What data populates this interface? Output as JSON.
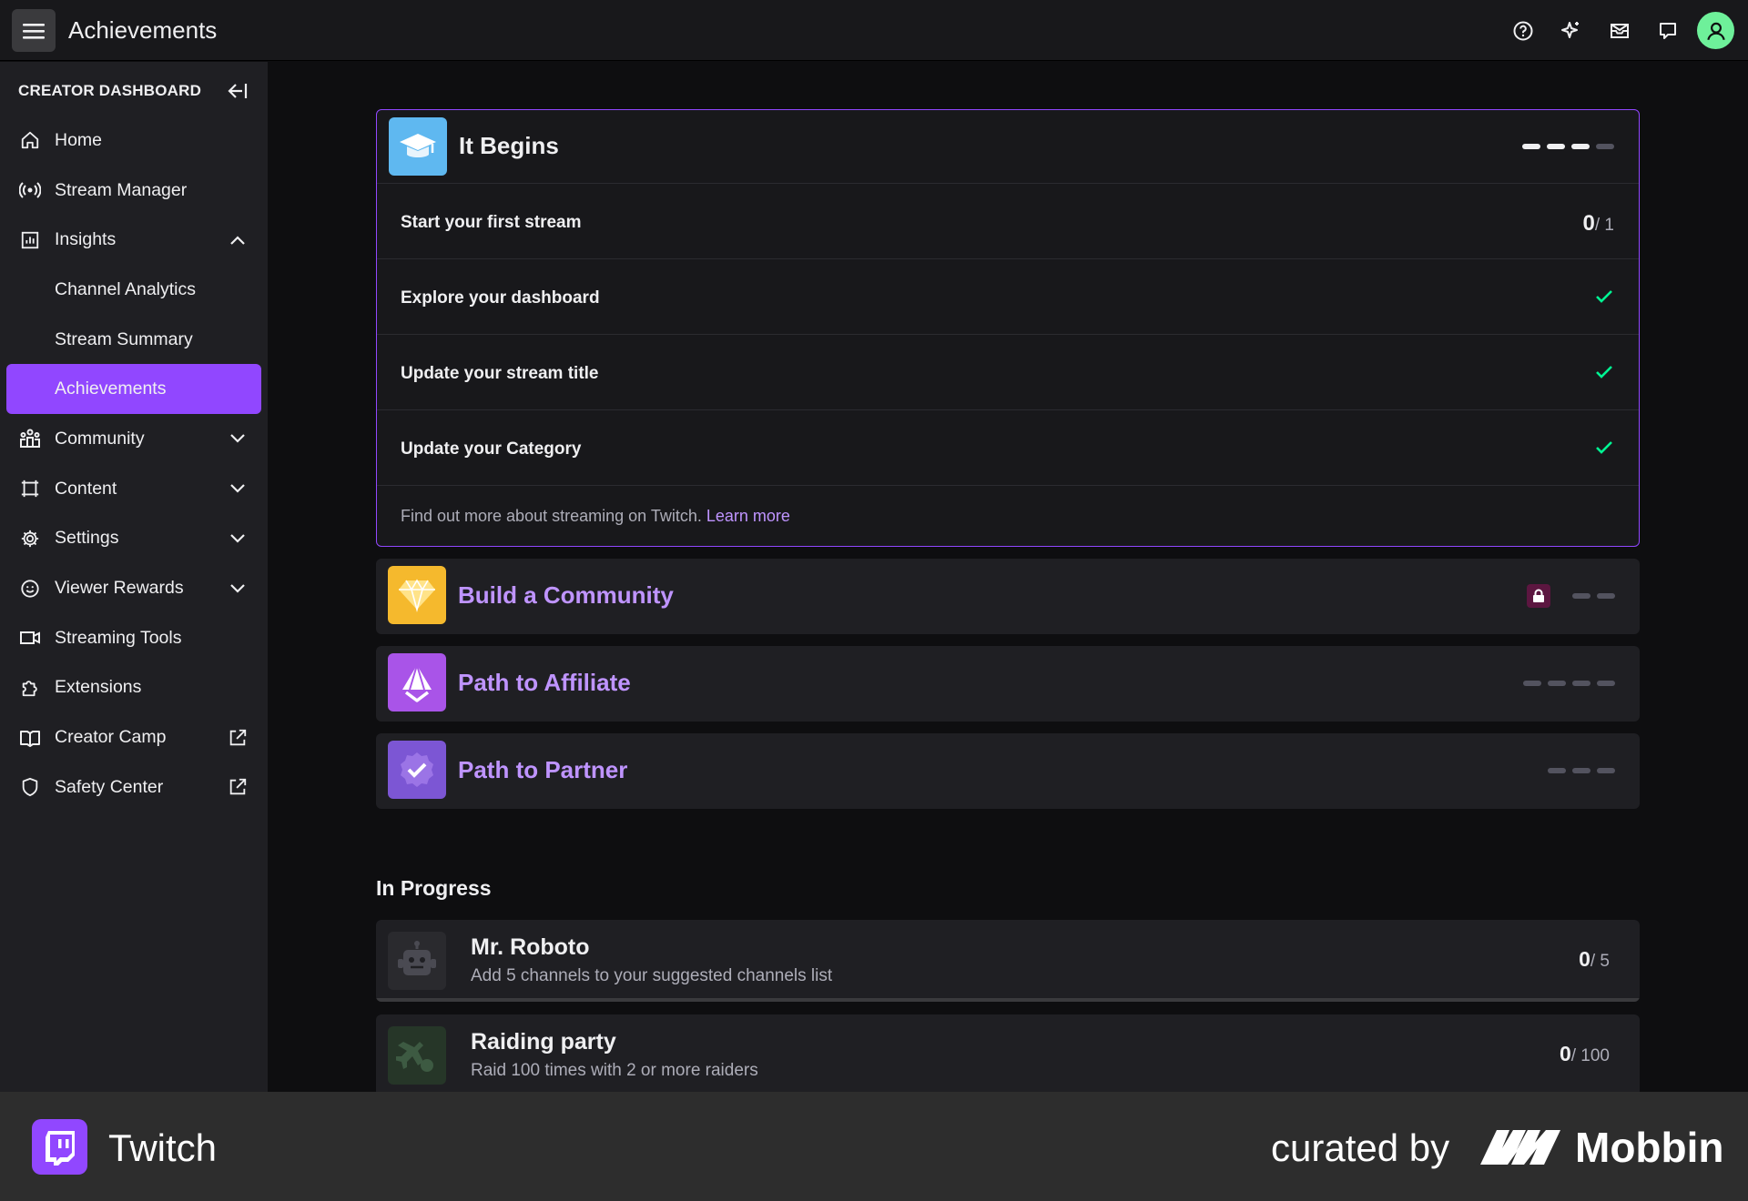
{
  "topbar": {
    "title": "Achievements",
    "icons": [
      "help-icon",
      "sparkle-icon",
      "inbox-icon",
      "whispers-icon",
      "avatar"
    ]
  },
  "sidebar": {
    "header": "CREATOR DASHBOARD",
    "items": [
      {
        "label": "Home",
        "icon": "home-icon"
      },
      {
        "label": "Stream Manager",
        "icon": "broadcast-icon"
      },
      {
        "label": "Insights",
        "icon": "insights-icon",
        "expanded": true
      },
      {
        "label": "Channel Analytics"
      },
      {
        "label": "Stream Summary"
      },
      {
        "label": "Achievements",
        "active": true
      },
      {
        "label": "Community",
        "icon": "community-icon"
      },
      {
        "label": "Content",
        "icon": "content-icon"
      },
      {
        "label": "Settings",
        "icon": "gear-icon"
      },
      {
        "label": "Viewer Rewards",
        "icon": "smile-icon"
      },
      {
        "label": "Streaming Tools",
        "icon": "camera-icon"
      },
      {
        "label": "Extensions",
        "icon": "puzzle-icon"
      },
      {
        "label": "Creator Camp",
        "icon": "book-icon",
        "external": true
      },
      {
        "label": "Safety Center",
        "icon": "shield-icon",
        "external": true
      }
    ]
  },
  "achievements": {
    "it_begins": {
      "title": "It Begins",
      "tasks": [
        {
          "label": "Start your first stream",
          "done_num": "0",
          "done_den": "/ 1"
        },
        {
          "label": "Explore your dashboard",
          "done": true
        },
        {
          "label": "Update your stream title",
          "done": true
        },
        {
          "label": "Update your Category",
          "done": true
        }
      ],
      "footer_text": "Find out more about streaming on Twitch.",
      "footer_link": "Learn more",
      "progress_segments": 4,
      "segments_done": 3
    },
    "build_community": {
      "title": "Build a Community",
      "locked": true,
      "progress_segments": 2
    },
    "path_affiliate": {
      "title": "Path to Affiliate",
      "progress_segments": 4
    },
    "path_partner": {
      "title": "Path to Partner",
      "progress_segments": 3
    }
  },
  "in_progress": {
    "title": "In Progress",
    "items": [
      {
        "name": "Mr. Roboto",
        "desc": "Add 5 channels to your suggested channels list",
        "num": "0",
        "den": "/ 5",
        "progress": 0
      },
      {
        "name": "Raiding party",
        "desc": "Raid 100 times with 2 or more raiders",
        "num": "0",
        "den": "/ 100",
        "progress": 0
      }
    ]
  },
  "brand": {
    "app": "Twitch",
    "curated": "curated by",
    "mobbin": "Mobbin"
  },
  "colors": {
    "accent": "#9147ff",
    "link": "#bf94ff",
    "check": "#00f593"
  }
}
